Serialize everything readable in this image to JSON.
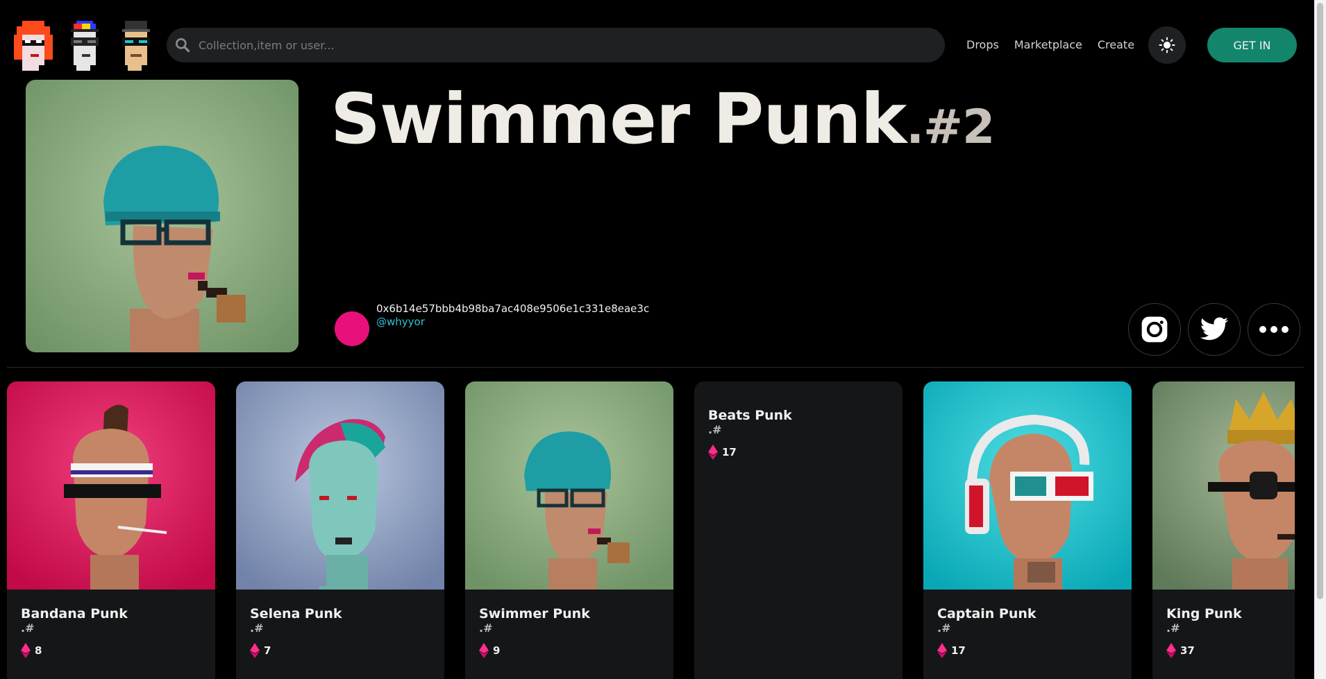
{
  "header": {
    "search_placeholder": "Collection,item or user...",
    "nav": [
      "Drops",
      "Marketplace",
      "Create"
    ],
    "cta_label": "GET IN"
  },
  "hero": {
    "title": "Swimmer Punk",
    "title_suffix": ".#2",
    "owner_address": "0x6b14e57bbb4b98ba7ac408e9506e1c331e8eae3c",
    "owner_handle": "@whyyor"
  },
  "cards": [
    {
      "name": "Bandana Punk",
      "hash": ".#",
      "price": "8",
      "bg": "#d90f56"
    },
    {
      "name": "Selena Punk",
      "hash": ".#",
      "price": "7",
      "bg": "#8ea0c3"
    },
    {
      "name": "Swimmer Punk",
      "hash": ".#",
      "price": "9",
      "bg": "#86a67f"
    },
    {
      "name": "Beats Punk",
      "hash": ".#",
      "price": "17",
      "bg": null
    },
    {
      "name": "Captain Punk",
      "hash": ".#",
      "price": "17",
      "bg": "#12c2cf"
    },
    {
      "name": "King Punk",
      "hash": ".#",
      "price": "37",
      "bg": "#6f8a69"
    }
  ],
  "colors": {
    "accent_green": "#13856b",
    "avatar_pink": "#e8107a",
    "handle_cyan": "#2ec4d8",
    "eth_pink": "#ff2d8c"
  }
}
